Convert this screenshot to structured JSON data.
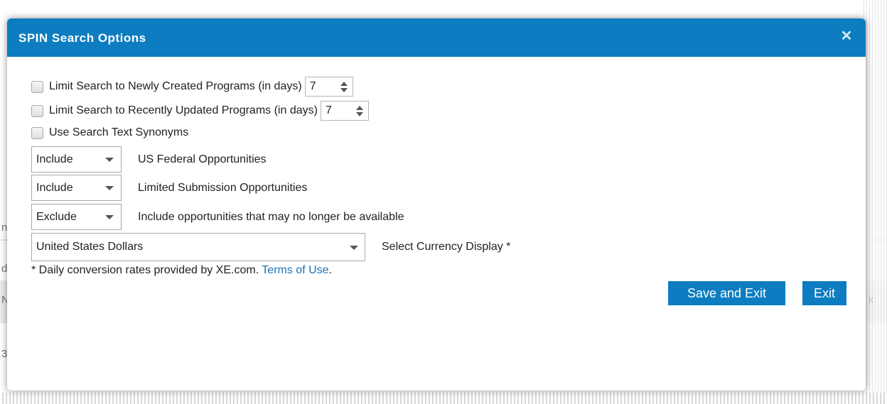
{
  "modal": {
    "title": "SPIN Search Options",
    "close_label": "✕"
  },
  "options": {
    "new_programs": {
      "label": "Limit Search to Newly Created Programs (in days)",
      "value": "7",
      "checked": false
    },
    "updated_programs": {
      "label": "Limit Search to Recently Updated Programs (in days)",
      "value": "7",
      "checked": false
    },
    "synonyms": {
      "label": "Use Search Text Synonyms",
      "checked": false
    }
  },
  "filters": [
    {
      "value": "Include",
      "label": "US Federal Opportunities"
    },
    {
      "value": "Include",
      "label": "Limited Submission Opportunities"
    },
    {
      "value": "Exclude",
      "label": "Include opportunities that may no longer be available"
    }
  ],
  "currency": {
    "value": "United States Dollars",
    "label": "Select Currency Display *"
  },
  "note": {
    "text": "* Daily conversion rates provided by XE.com. ",
    "link": "Terms of Use",
    "end": "."
  },
  "buttons": {
    "save_exit": "Save and Exit",
    "exit": "Exit"
  },
  "background": {
    "frag_a": "n",
    "frag_b": "dr",
    "frag_c": "N",
    "frag_d": "3",
    "frag_e": "k"
  },
  "colors": {
    "accent": "#0e7cc0",
    "link": "#1a73b5"
  }
}
